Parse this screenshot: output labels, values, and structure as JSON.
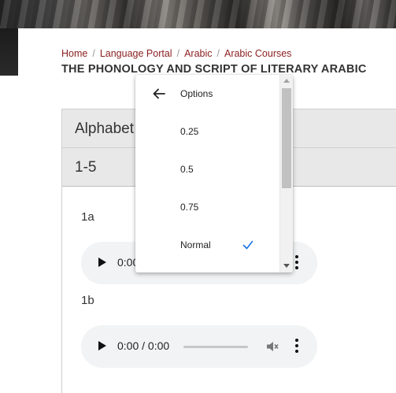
{
  "breadcrumb": {
    "items": [
      "Home",
      "Language Portal",
      "Arabic",
      "Arabic Courses"
    ],
    "separator": "/"
  },
  "page_title": "THE PHONOLOGY AND SCRIPT OF LITERARY ARABIC",
  "panel": {
    "header": "Alphabet",
    "subheader": "1-5"
  },
  "items": [
    {
      "label": "1a",
      "audio": {
        "time": "0:00 / 0:00"
      }
    },
    {
      "label": "1b",
      "audio": {
        "time": "0:00 / 0:00"
      }
    }
  ],
  "speed_menu": {
    "back_label": "Options",
    "options": [
      "0.25",
      "0.5",
      "0.75",
      "Normal"
    ],
    "selected": "Normal"
  },
  "colors": {
    "link": "#8a1e1e",
    "header_bg": "#e8e8e8",
    "audio_bg": "#f1f3f4",
    "check": "#1a73e8"
  }
}
